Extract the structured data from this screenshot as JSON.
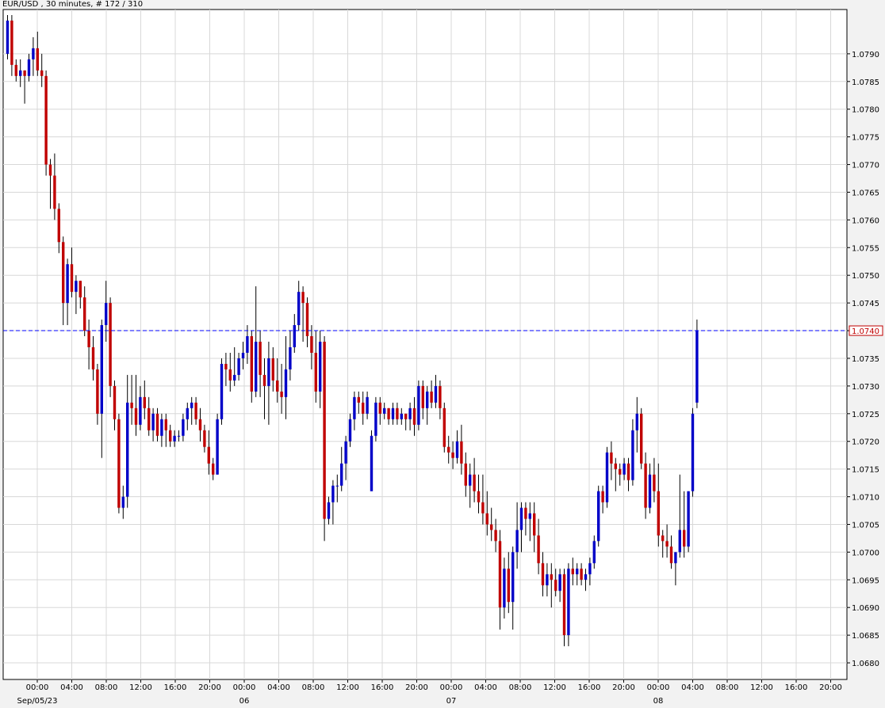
{
  "header": {
    "title": "EUR/USD , 30 minutes, # 172 / 310"
  },
  "chart_data": {
    "type": "candlestick",
    "title": "EUR/USD , 30 minutes, # 172 / 310",
    "ylim": [
      1.0677,
      1.0798
    ],
    "yticks": [
      "1.0680",
      "1.0685",
      "1.0690",
      "1.0695",
      "1.0700",
      "1.0705",
      "1.0710",
      "1.0715",
      "1.0720",
      "1.0725",
      "1.0730",
      "1.0735",
      "1.0740",
      "1.0745",
      "1.0750",
      "1.0755",
      "1.0760",
      "1.0765",
      "1.0770",
      "1.0775",
      "1.0780",
      "1.0785",
      "1.0790"
    ],
    "xticks": [
      "00:00",
      "04:00",
      "08:00",
      "12:00",
      "16:00",
      "20:00",
      "00:00",
      "04:00",
      "08:00",
      "12:00",
      "16:00",
      "20:00",
      "00:00",
      "04:00",
      "08:00",
      "12:00",
      "16:00",
      "20:00",
      "00:00",
      "04:00",
      "08:00",
      "12:00",
      "16:00",
      "20:00"
    ],
    "dates": [
      "Sep/05/23",
      "06",
      "07",
      "08"
    ],
    "current_price": 1.074,
    "current_price_label": "1.0740",
    "colors": {
      "up": "#0000c8",
      "down": "#c00000",
      "grid": "#d8d8d8",
      "price_line": "#0000ff"
    },
    "candles": [
      [
        1.079,
        1.0797,
        1.0789,
        1.0796
      ],
      [
        1.0796,
        1.0797,
        1.0786,
        1.0788
      ],
      [
        1.0788,
        1.0789,
        1.0785,
        1.0786
      ],
      [
        1.0786,
        1.0789,
        1.0784,
        1.0787
      ],
      [
        1.0787,
        1.0787,
        1.0781,
        1.0786
      ],
      [
        1.0786,
        1.079,
        1.0785,
        1.0789
      ],
      [
        1.0789,
        1.0793,
        1.0786,
        1.0791
      ],
      [
        1.0791,
        1.0794,
        1.0786,
        1.0787
      ],
      [
        1.0787,
        1.079,
        1.0784,
        1.0786
      ],
      [
        1.0786,
        1.0787,
        1.0768,
        1.077
      ],
      [
        1.077,
        1.0771,
        1.0762,
        1.0768
      ],
      [
        1.0768,
        1.0772,
        1.076,
        1.0762
      ],
      [
        1.0762,
        1.0763,
        1.0754,
        1.0756
      ],
      [
        1.0756,
        1.0757,
        1.0741,
        1.0745
      ],
      [
        1.0745,
        1.0753,
        1.0741,
        1.0752
      ],
      [
        1.0752,
        1.0755,
        1.0746,
        1.0747
      ],
      [
        1.0747,
        1.075,
        1.0743,
        1.0749
      ],
      [
        1.0749,
        1.0749,
        1.0744,
        1.0746
      ],
      [
        1.0746,
        1.0748,
        1.0739,
        1.074
      ],
      [
        1.074,
        1.0742,
        1.0733,
        1.0737
      ],
      [
        1.0737,
        1.0739,
        1.0731,
        1.0733
      ],
      [
        1.0733,
        1.0734,
        1.0723,
        1.0725
      ],
      [
        1.0725,
        1.0742,
        1.0717,
        1.0741
      ],
      [
        1.0741,
        1.0749,
        1.0738,
        1.0745
      ],
      [
        1.0745,
        1.0746,
        1.0728,
        1.073
      ],
      [
        1.073,
        1.0731,
        1.0722,
        1.0724
      ],
      [
        1.0724,
        1.0725,
        1.0707,
        1.0708
      ],
      [
        1.0708,
        1.0712,
        1.0706,
        1.071
      ],
      [
        1.071,
        1.0732,
        1.0708,
        1.0727
      ],
      [
        1.0727,
        1.0732,
        1.0723,
        1.0726
      ],
      [
        1.0726,
        1.0732,
        1.0721,
        1.0723
      ],
      [
        1.0723,
        1.073,
        1.0722,
        1.0728
      ],
      [
        1.0728,
        1.0731,
        1.0724,
        1.0726
      ],
      [
        1.0726,
        1.0728,
        1.0721,
        1.0722
      ],
      [
        1.0722,
        1.0726,
        1.072,
        1.0725
      ],
      [
        1.0725,
        1.0726,
        1.072,
        1.0721
      ],
      [
        1.0721,
        1.0725,
        1.0719,
        1.0724
      ],
      [
        1.0724,
        1.0725,
        1.0719,
        1.0722
      ],
      [
        1.0722,
        1.0723,
        1.0719,
        1.072
      ],
      [
        1.072,
        1.0722,
        1.0719,
        1.0721
      ],
      [
        1.0721,
        1.0722,
        1.072,
        1.0721
      ],
      [
        1.0721,
        1.0725,
        1.072,
        1.0724
      ],
      [
        1.0724,
        1.0727,
        1.0722,
        1.0726
      ],
      [
        1.0726,
        1.0728,
        1.0723,
        1.0727
      ],
      [
        1.0727,
        1.0728,
        1.0723,
        1.0724
      ],
      [
        1.0724,
        1.0726,
        1.072,
        1.0722
      ],
      [
        1.0722,
        1.0723,
        1.0718,
        1.0719
      ],
      [
        1.0719,
        1.0722,
        1.0714,
        1.0716
      ],
      [
        1.0716,
        1.0717,
        1.0713,
        1.0714
      ],
      [
        1.0714,
        1.0725,
        1.0714,
        1.0724
      ],
      [
        1.0724,
        1.0735,
        1.0723,
        1.0734
      ],
      [
        1.0734,
        1.0736,
        1.073,
        1.0733
      ],
      [
        1.0733,
        1.0736,
        1.0729,
        1.0731
      ],
      [
        1.0731,
        1.0737,
        1.073,
        1.0732
      ],
      [
        1.0732,
        1.0736,
        1.0731,
        1.0735
      ],
      [
        1.0735,
        1.0738,
        1.0733,
        1.0736
      ],
      [
        1.0736,
        1.0741,
        1.0734,
        1.0739
      ],
      [
        1.0739,
        1.074,
        1.0727,
        1.0729
      ],
      [
        1.0729,
        1.0748,
        1.0728,
        1.0738
      ],
      [
        1.0738,
        1.074,
        1.0728,
        1.0732
      ],
      [
        1.0732,
        1.0735,
        1.0724,
        1.073
      ],
      [
        1.073,
        1.0738,
        1.0723,
        1.0735
      ],
      [
        1.0735,
        1.0737,
        1.0729,
        1.0731
      ],
      [
        1.0731,
        1.0735,
        1.0727,
        1.0729
      ],
      [
        1.0729,
        1.0734,
        1.0725,
        1.0728
      ],
      [
        1.0728,
        1.0739,
        1.0724,
        1.0733
      ],
      [
        1.0733,
        1.074,
        1.0731,
        1.0737
      ],
      [
        1.0737,
        1.0743,
        1.0736,
        1.0741
      ],
      [
        1.0741,
        1.0749,
        1.074,
        1.0747
      ],
      [
        1.0747,
        1.0748,
        1.0738,
        1.0745
      ],
      [
        1.0745,
        1.0746,
        1.0737,
        1.0739
      ],
      [
        1.0739,
        1.0741,
        1.0733,
        1.0736
      ],
      [
        1.0736,
        1.074,
        1.0727,
        1.0729
      ],
      [
        1.0729,
        1.074,
        1.0726,
        1.0738
      ],
      [
        1.0738,
        1.0739,
        1.0702,
        1.0706
      ],
      [
        1.0706,
        1.071,
        1.0705,
        1.0709
      ],
      [
        1.0709,
        1.0713,
        1.0705,
        1.0712
      ],
      [
        1.0712,
        1.0714,
        1.0709,
        1.0712
      ],
      [
        1.0712,
        1.0719,
        1.0711,
        1.0716
      ],
      [
        1.0716,
        1.0721,
        1.0713,
        1.072
      ],
      [
        1.072,
        1.0725,
        1.0719,
        1.0724
      ],
      [
        1.0724,
        1.0729,
        1.0722,
        1.0728
      ],
      [
        1.0728,
        1.0729,
        1.0725,
        1.0727
      ],
      [
        1.0727,
        1.0729,
        1.0723,
        1.0725
      ],
      [
        1.0725,
        1.0729,
        1.0724,
        1.0728
      ],
      [
        1.0711,
        1.0722,
        1.0711,
        1.0721
      ],
      [
        1.0721,
        1.0728,
        1.072,
        1.0727
      ],
      [
        1.0727,
        1.0728,
        1.0723,
        1.0725
      ],
      [
        1.0725,
        1.0727,
        1.0724,
        1.0726
      ],
      [
        1.0726,
        1.0726,
        1.0723,
        1.0724
      ],
      [
        1.0724,
        1.0727,
        1.0723,
        1.0726
      ],
      [
        1.0726,
        1.0727,
        1.0723,
        1.0724
      ],
      [
        1.0724,
        1.0726,
        1.0723,
        1.0725
      ],
      [
        1.0725,
        1.0725,
        1.0722,
        1.0724
      ],
      [
        1.0724,
        1.0727,
        1.0722,
        1.0726
      ],
      [
        1.0726,
        1.0728,
        1.0721,
        1.0723
      ],
      [
        1.0723,
        1.0731,
        1.0722,
        1.073
      ],
      [
        1.073,
        1.0731,
        1.0724,
        1.0726
      ],
      [
        1.0726,
        1.073,
        1.0723,
        1.0729
      ],
      [
        1.0729,
        1.0731,
        1.0726,
        1.0727
      ],
      [
        1.0727,
        1.0732,
        1.0726,
        1.073
      ],
      [
        1.073,
        1.0731,
        1.0724,
        1.0726
      ],
      [
        1.0726,
        1.0727,
        1.0718,
        1.0719
      ],
      [
        1.0719,
        1.0721,
        1.0716,
        1.0718
      ],
      [
        1.0718,
        1.072,
        1.0715,
        1.0717
      ],
      [
        1.0717,
        1.0722,
        1.0716,
        1.072
      ],
      [
        1.072,
        1.0723,
        1.0714,
        1.0716
      ],
      [
        1.0716,
        1.0718,
        1.071,
        1.0712
      ],
      [
        1.0712,
        1.0716,
        1.0708,
        1.0714
      ],
      [
        1.0714,
        1.0717,
        1.0709,
        1.0711
      ],
      [
        1.0711,
        1.0714,
        1.0707,
        1.0709
      ],
      [
        1.0709,
        1.0714,
        1.0705,
        1.0707
      ],
      [
        1.0707,
        1.0711,
        1.0703,
        1.0705
      ],
      [
        1.0705,
        1.0708,
        1.0702,
        1.0704
      ],
      [
        1.0704,
        1.0706,
        1.07,
        1.0702
      ],
      [
        1.0702,
        1.0704,
        1.0686,
        1.069
      ],
      [
        1.069,
        1.0699,
        1.0688,
        1.0697
      ],
      [
        1.0697,
        1.07,
        1.0689,
        1.0691
      ],
      [
        1.0691,
        1.0701,
        1.0686,
        1.07
      ],
      [
        1.07,
        1.0709,
        1.0697,
        1.0704
      ],
      [
        1.0704,
        1.0709,
        1.07,
        1.0708
      ],
      [
        1.0708,
        1.0709,
        1.0703,
        1.0706
      ],
      [
        1.0706,
        1.0709,
        1.0702,
        1.0707
      ],
      [
        1.0707,
        1.0709,
        1.07,
        1.0703
      ],
      [
        1.0703,
        1.0706,
        1.0696,
        1.0698
      ],
      [
        1.0698,
        1.07,
        1.0692,
        1.0694
      ],
      [
        1.0694,
        1.0698,
        1.0692,
        1.0696
      ],
      [
        1.0696,
        1.0698,
        1.069,
        1.0695
      ],
      [
        1.0695,
        1.0697,
        1.0692,
        1.0693
      ],
      [
        1.0693,
        1.0697,
        1.0691,
        1.0696
      ],
      [
        1.0696,
        1.0697,
        1.0683,
        1.0685
      ],
      [
        1.0685,
        1.0698,
        1.0683,
        1.0697
      ],
      [
        1.0697,
        1.0699,
        1.0694,
        1.0696
      ],
      [
        1.0696,
        1.0698,
        1.0694,
        1.0697
      ],
      [
        1.0697,
        1.0698,
        1.0694,
        1.0695
      ],
      [
        1.0695,
        1.0697,
        1.0693,
        1.0696
      ],
      [
        1.0696,
        1.0699,
        1.0694,
        1.0698
      ],
      [
        1.0698,
        1.0703,
        1.0697,
        1.0702
      ],
      [
        1.0702,
        1.0712,
        1.0701,
        1.0711
      ],
      [
        1.0711,
        1.0712,
        1.0707,
        1.0709
      ],
      [
        1.0709,
        1.0719,
        1.0708,
        1.0718
      ],
      [
        1.0718,
        1.072,
        1.0713,
        1.0716
      ],
      [
        1.0716,
        1.0717,
        1.0711,
        1.0715
      ],
      [
        1.0715,
        1.0716,
        1.0712,
        1.0714
      ],
      [
        1.0714,
        1.0717,
        1.0713,
        1.0716
      ],
      [
        1.0716,
        1.0717,
        1.0711,
        1.0713
      ],
      [
        1.0713,
        1.0724,
        1.0712,
        1.0722
      ],
      [
        1.0722,
        1.0728,
        1.0718,
        1.0725
      ],
      [
        1.0725,
        1.0726,
        1.0715,
        1.0716
      ],
      [
        1.0716,
        1.0718,
        1.0706,
        1.0708
      ],
      [
        1.0708,
        1.0716,
        1.0707,
        1.0714
      ],
      [
        1.0714,
        1.0717,
        1.0709,
        1.0711
      ],
      [
        1.0711,
        1.0716,
        1.0701,
        1.0703
      ],
      [
        1.0703,
        1.0704,
        1.0699,
        1.0702
      ],
      [
        1.0702,
        1.0705,
        1.0699,
        1.0701
      ],
      [
        1.0701,
        1.0703,
        1.0697,
        1.0698
      ],
      [
        1.0698,
        1.07,
        1.0694,
        1.07
      ],
      [
        1.07,
        1.0714,
        1.0699,
        1.0704
      ],
      [
        1.0704,
        1.0711,
        1.0699,
        1.0701
      ],
      [
        1.0701,
        1.0711,
        1.07,
        1.0711
      ],
      [
        1.0711,
        1.0726,
        1.071,
        1.0725
      ],
      [
        1.0727,
        1.0742,
        1.0726,
        1.074
      ]
    ]
  }
}
